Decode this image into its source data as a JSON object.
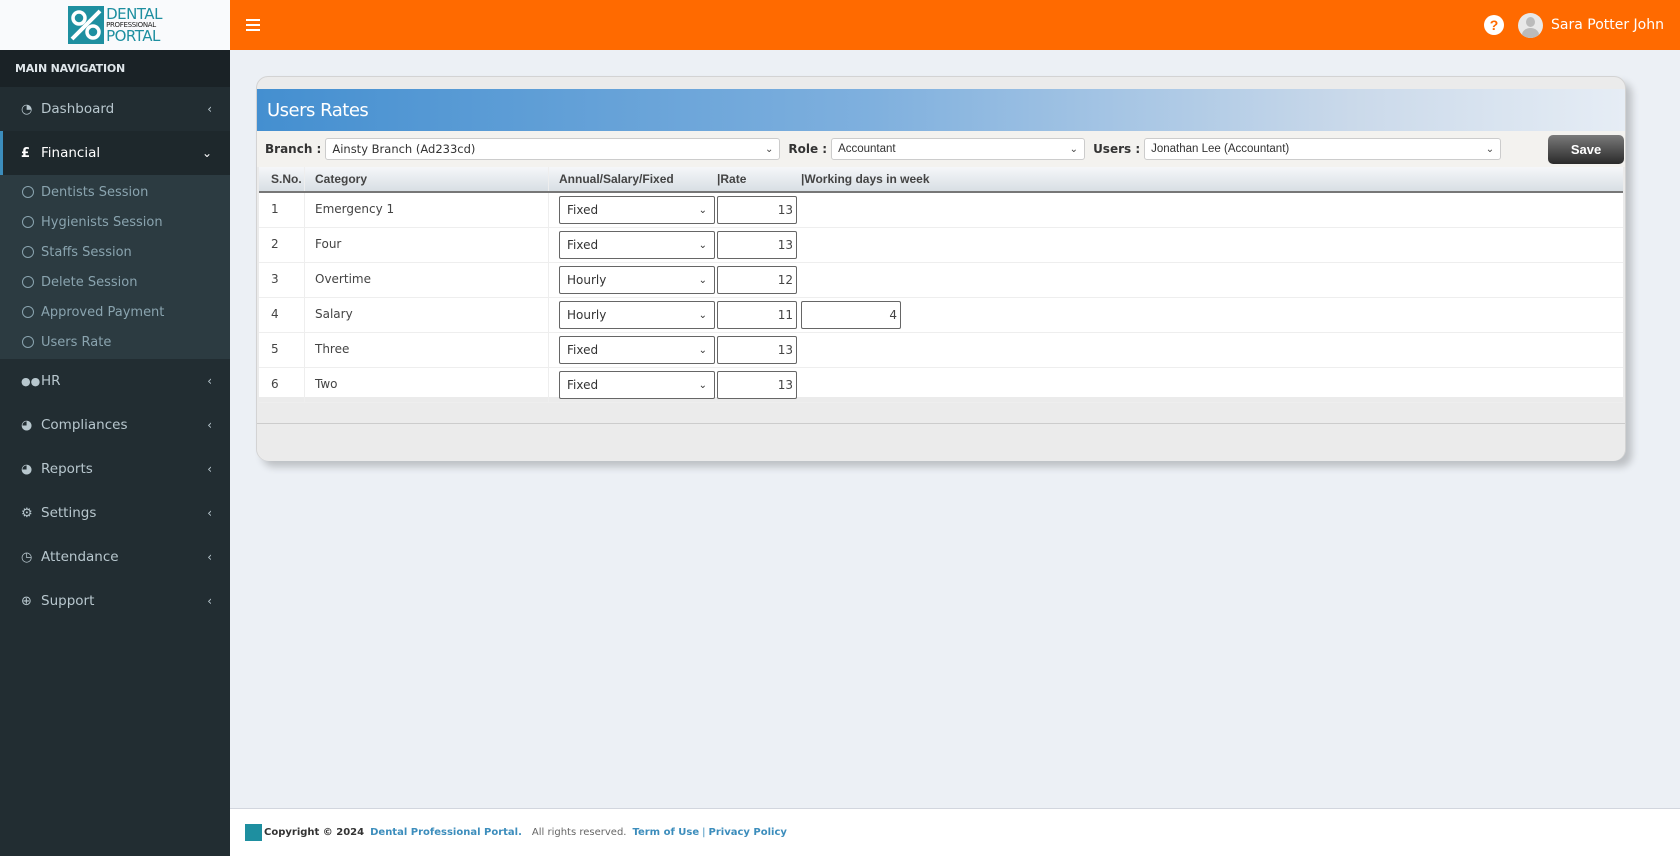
{
  "app": {
    "logo": {
      "line1": "DENTAL",
      "line2": "PROFESSIONAL",
      "line3": "PORTAL"
    },
    "user_name": "Sara Potter John",
    "header_icons": [
      "hamburger-icon",
      "help-icon",
      "avatar"
    ]
  },
  "sidebar": {
    "header": "MAIN NAVIGATION",
    "items": [
      {
        "label": "Dashboard",
        "icon": "dashboard-icon",
        "glyph": "◔",
        "chevron": "‹",
        "active": false
      },
      {
        "label": "Financial",
        "icon": "pound-icon",
        "glyph": "£",
        "chevron": "⌄",
        "active": true,
        "children": [
          "Dentists Session",
          "Hygienists Session",
          "Staffs Session",
          "Delete Session",
          "Approved Payment",
          "Users Rate"
        ]
      },
      {
        "label": "HR",
        "icon": "users-icon",
        "glyph": "👥",
        "chevron": "‹",
        "active": false
      },
      {
        "label": "Compliances",
        "icon": "pie-chart-icon",
        "glyph": "◕",
        "chevron": "‹",
        "active": false
      },
      {
        "label": "Reports",
        "icon": "pie-chart-icon",
        "glyph": "◕",
        "chevron": "‹",
        "active": false
      },
      {
        "label": "Settings",
        "icon": "gear-icon",
        "glyph": "⚙",
        "chevron": "‹",
        "active": false
      },
      {
        "label": "Attendance",
        "icon": "clock-icon",
        "glyph": "◷",
        "chevron": "‹",
        "active": false
      },
      {
        "label": "Support",
        "icon": "life-ring-icon",
        "glyph": "⊕",
        "chevron": "‹",
        "active": false
      }
    ]
  },
  "panel": {
    "title": "Users Rates",
    "filters": {
      "branch_label": "Branch :",
      "branch_value": "Ainsty Branch (Ad233cd)",
      "role_label": "Role :",
      "role_value": "Accountant",
      "users_label": "Users :",
      "users_value": "Jonathan Lee (Accountant)"
    },
    "save_label": "Save",
    "columns": [
      "S.No.",
      "Category",
      "Annual/Salary/Fixed",
      "|Rate",
      "|Working days in week"
    ],
    "rows": [
      {
        "sno": "1",
        "category": "Emergency 1",
        "type": "Fixed",
        "rate": "13",
        "days": null
      },
      {
        "sno": "2",
        "category": "Four",
        "type": "Fixed",
        "rate": "13",
        "days": null
      },
      {
        "sno": "3",
        "category": "Overtime",
        "type": "Hourly",
        "rate": "12",
        "days": null
      },
      {
        "sno": "4",
        "category": "Salary",
        "type": "Hourly",
        "rate": "11",
        "days": "4"
      },
      {
        "sno": "5",
        "category": "Three",
        "type": "Fixed",
        "rate": "13",
        "days": null
      },
      {
        "sno": "6",
        "category": "Two",
        "type": "Fixed",
        "rate": "13",
        "days": null
      }
    ]
  },
  "footer": {
    "copyright": "Copyright © 2024",
    "brand": "Dental Professional Portal.",
    "rights": "All rights reserved.",
    "terms": "Term of Use",
    "separator": "|",
    "privacy": "Privacy Policy"
  }
}
